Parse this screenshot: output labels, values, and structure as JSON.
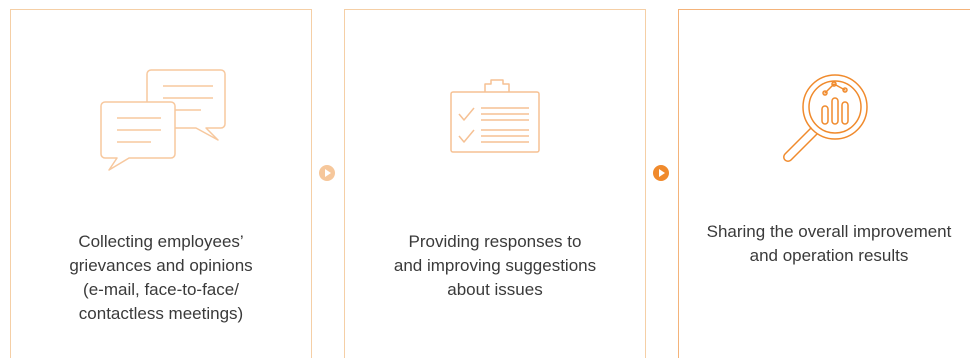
{
  "steps": [
    {
      "icon": "chat-bubbles-icon",
      "lines": [
        "Collecting employees’",
        "grievances and opinions",
        "(e-mail, face-to-face/",
        "contactless meetings)"
      ]
    },
    {
      "icon": "clipboard-checklist-icon",
      "lines": [
        "Providing responses to",
        "and improving suggestions",
        "about issues"
      ]
    },
    {
      "icon": "magnifier-chart-icon",
      "lines": [
        "Sharing the overall improvement",
        "and operation results"
      ]
    }
  ],
  "colors": {
    "light_orange": "#f5cfa6",
    "mid_orange": "#f4b37a",
    "accent_orange": "#f08a2c",
    "arrow_light": "#f6c79b",
    "text": "#3a3a3a"
  }
}
